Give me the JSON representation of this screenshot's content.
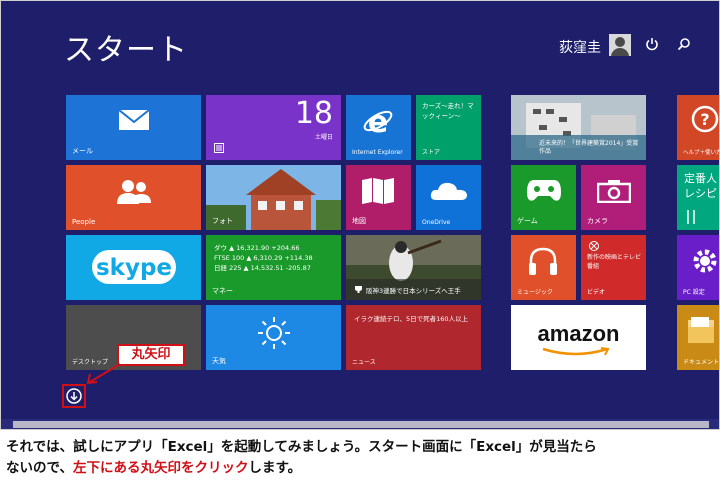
{
  "start_title": "スタート",
  "user_name": "荻窪圭",
  "tiles": {
    "mail": "メール",
    "calendar_day": "18",
    "calendar_weekday": "土曜日",
    "ie": "Internet Explorer",
    "store_news": "カーズ〜走れ！マックィーン〜",
    "store": "ストア",
    "travel_caption": "近未来的！「世界建築賞2014」受賞作品",
    "help": "ヘルプ＋使い方",
    "people": "People",
    "photos": "フォト",
    "maps": "地図",
    "onedrive": "OneDrive",
    "games": "ゲーム",
    "camera": "カメラ",
    "recipe": "定番人レシピ",
    "skype": "skype",
    "finance_rows": [
      "ダウ ▲ 16,321.90 +204.66",
      "FTSE 100 ▲ 6,310.29 +114.38",
      "日経 225 ▲ 14,532.51 -205.87"
    ],
    "money": "マネー",
    "sports_caption": "阪神3連勝で日本シリーズへ王手",
    "music": "ミュージック",
    "video_caption": "新作の映画とテレビ番組",
    "video": "ビデオ",
    "pc_settings": "PC 設定",
    "desktop": "デスクトップ",
    "weather": "天気",
    "news_headline": "イラク連続テロ、5日で死者160人以上",
    "news": "ニュース",
    "amazon": "amazon",
    "documents": "ドキュメント"
  },
  "callout_label": "丸矢印",
  "caption": {
    "line1": "それでは、試しにアプリ「Excel」を起動してみましょう。スタート画面に「Excel」が見当たら",
    "line2_prefix": "ないので、",
    "line2_highlight": "左下にある丸矢印をクリック",
    "line2_suffix": "します。"
  },
  "colors": {
    "background": "#1e1e6b",
    "accent_red": "#d01016"
  }
}
